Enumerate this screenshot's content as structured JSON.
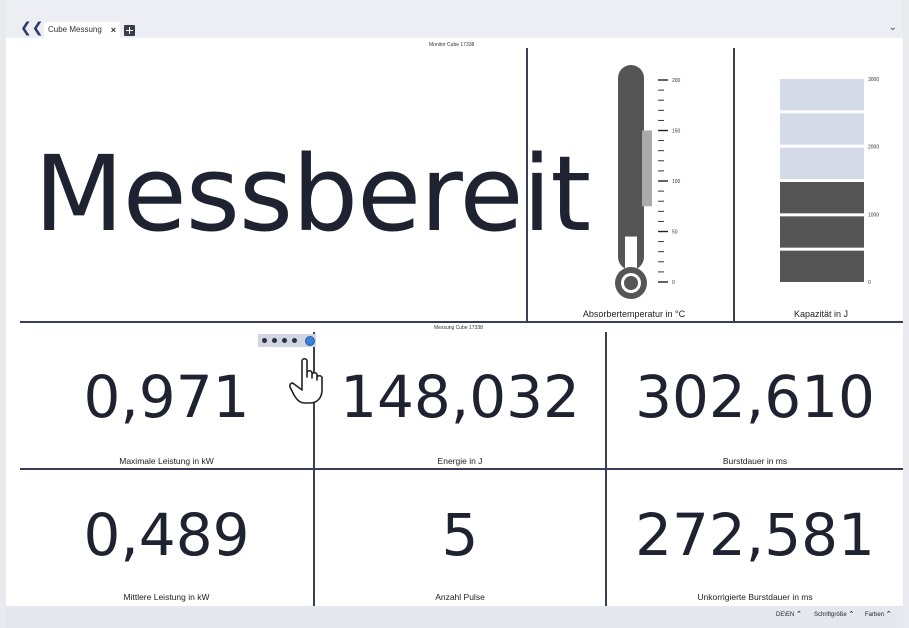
{
  "tabs": {
    "active_label": "Cube Messung",
    "close_glyph": "×"
  },
  "top": {
    "title": "Monitor Cube 17338",
    "status": "Messbereit"
  },
  "thermometer": {
    "label": "Absorbertemperatur in °C",
    "ticks": [
      "200",
      "150",
      "100",
      "50",
      "0"
    ],
    "range": [
      0,
      200
    ],
    "fill_value": 45,
    "band_range": [
      75,
      150
    ]
  },
  "capacity": {
    "label": "Kapazität in J",
    "ticks": [
      "3000",
      "2000",
      "1000",
      "0"
    ],
    "range": [
      0,
      3000
    ],
    "segments_total": 6,
    "segments_filled": 3
  },
  "bottom": {
    "title": "Messung Cube 17338",
    "metrics": [
      {
        "value": "0,971",
        "label": "Maximale Leistung in kW"
      },
      {
        "value": "148,032",
        "label": "Energie in J"
      },
      {
        "value": "302,610",
        "label": "Burstdauer in ms"
      },
      {
        "value": "0,489",
        "label": "Mittlere Leistung in kW"
      },
      {
        "value": "5",
        "label": "Anzahl Pulse"
      },
      {
        "value": "272,581",
        "label": "Unkorrigierte Burstdauer in ms"
      }
    ]
  },
  "statusbar": {
    "language": "DE\\EN",
    "font_size": "Schriftgröße",
    "colors": "Farben"
  },
  "colors": {
    "dark": "#555555",
    "light": "#d5dae8",
    "divider": "#3a3f55",
    "gear": "#3b7fd6"
  }
}
